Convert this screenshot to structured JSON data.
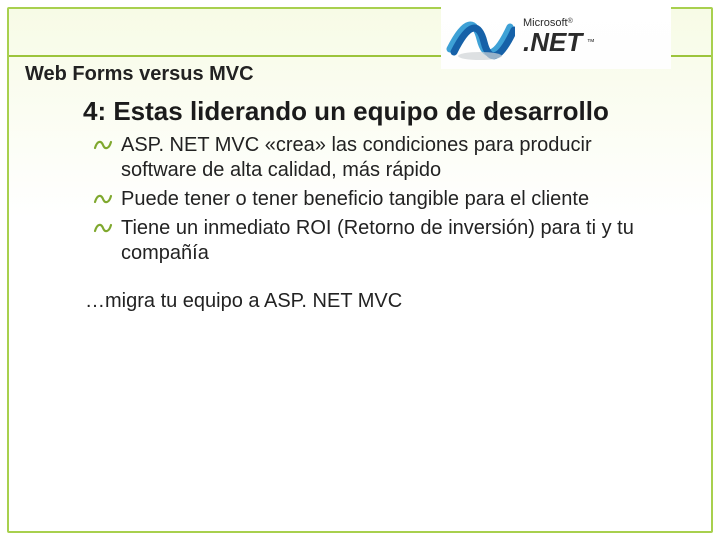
{
  "header": {
    "title": "Web Forms versus MVC",
    "logo": {
      "brand": "Microsoft",
      "reg": "®",
      "product": ".NET",
      "tm": "™"
    }
  },
  "slide": {
    "title": "4: Estas liderando un equipo de desarrollo",
    "bullets": [
      "ASP. NET MVC «crea» las condiciones para producir software de alta calidad, más rápido",
      "Puede tener o tener beneficio tangible para el cliente",
      "Tiene un inmediato ROI (Retorno de inversión) para ti y tu compañía"
    ],
    "conclusion": "…migra tu equipo a ASP. NET MVC"
  },
  "colors": {
    "accent": "#9cc43c",
    "bullet": "#7fa82e"
  }
}
